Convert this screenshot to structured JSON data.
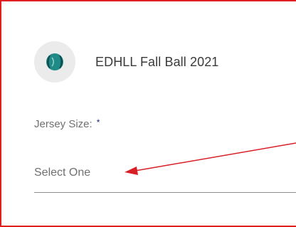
{
  "event": {
    "title": "EDHLL Fall Ball 2021",
    "logo_icon": "ball-icon"
  },
  "form": {
    "jersey_size": {
      "label": "Jersey Size:",
      "required_marker": "*",
      "value": "Select One"
    }
  },
  "colors": {
    "frame_border": "#e02020",
    "annotation_arrow": "#d81f26",
    "logo_teal": "#1f8a86",
    "logo_dark": "#0f4e52",
    "required_star": "#1d2a6e"
  }
}
